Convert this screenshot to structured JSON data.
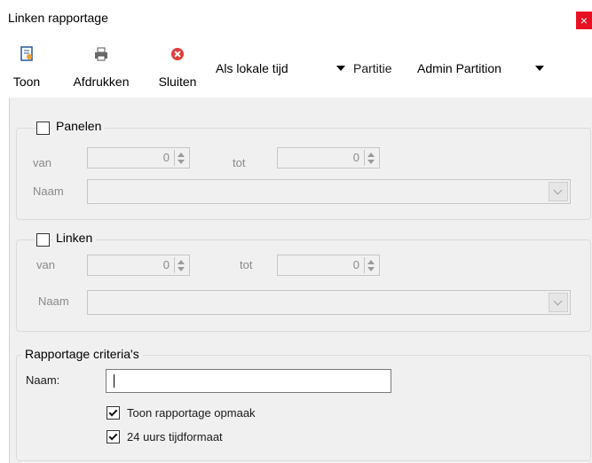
{
  "window": {
    "title": "Linken rapportage",
    "close_glyph": "×"
  },
  "toolbar": {
    "buttons": [
      {
        "label": "Toon",
        "icon": "show-report-icon"
      },
      {
        "label": "Afdrukken",
        "icon": "printer-icon"
      },
      {
        "label": "Sluiten",
        "icon": "close-circle-icon"
      }
    ],
    "time_mode": "Als lokale tijd",
    "partition_label": "Partitie",
    "partition_value": "Admin Partition"
  },
  "panelen": {
    "title": "Panelen",
    "checked": false,
    "van_label": "van",
    "van_value": "0",
    "tot_label": "tot",
    "tot_value": "0",
    "naam_label": "Naam"
  },
  "linken": {
    "title": "Linken",
    "checked": false,
    "van_label": "van",
    "van_value": "0",
    "tot_label": "tot",
    "tot_value": "0",
    "naam_label": "Naam"
  },
  "criteria": {
    "title": "Rapportage criteria's",
    "naam_label": "Naam:",
    "naam_value": "",
    "show_layout_label": "Toon rapportage opmaak",
    "show_layout_checked": true,
    "hour24_label": "24 uurs tijdformaat",
    "hour24_checked": true
  },
  "colors": {
    "close": "#e81123",
    "client_bg": "#f0f0f0",
    "disabled_text": "#8a8a8a"
  }
}
